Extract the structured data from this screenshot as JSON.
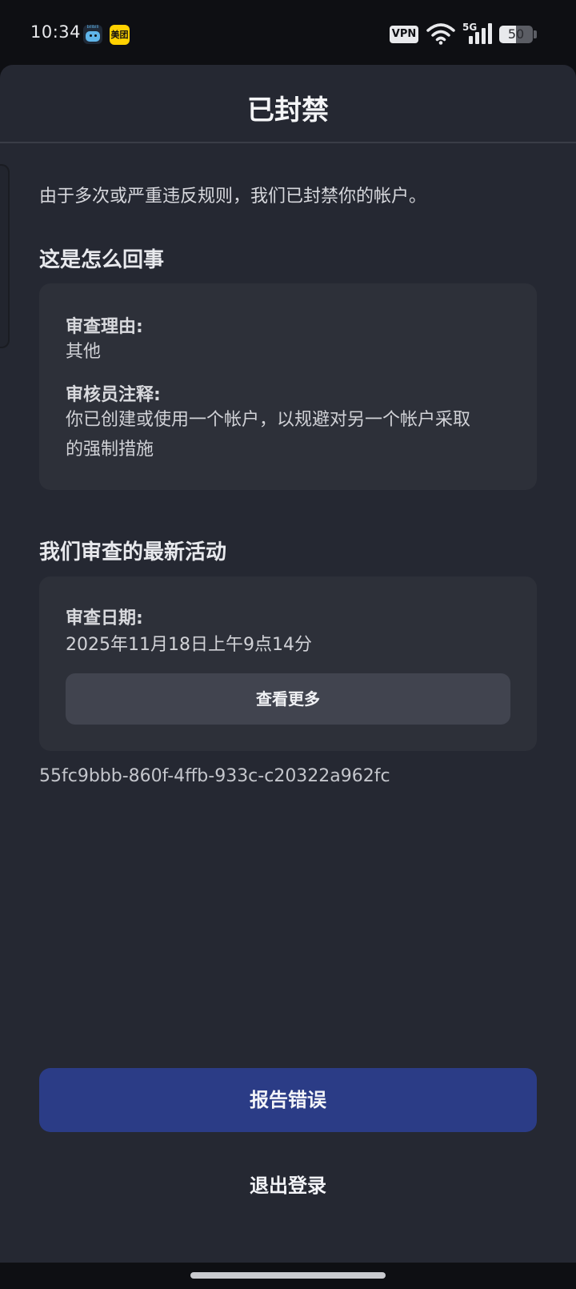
{
  "status_bar": {
    "time": "10:34",
    "app1_icon_text": "bilibili",
    "app2_icon_text": "美团",
    "vpn_label": "VPN",
    "network_label": "5G",
    "battery_level": "50",
    "battery_fraction": 0.5,
    "icons": [
      "bilibili-app-icon",
      "meituan-app-icon",
      "vpn-icon",
      "wifi-icon",
      "5g-signal-icon",
      "battery-icon"
    ]
  },
  "sheet": {
    "title": "已封禁",
    "intro": "由于多次或严重违反规则，我们已封禁你的帐户。"
  },
  "what_happened": {
    "heading": "这是怎么回事",
    "reason_label": "审查理由:",
    "reason_value": "其他",
    "note_label": "审核员注释:",
    "note_line1": "你已创建或使用一个帐户，以规避对另一个帐户采取",
    "note_line2": "的强制措施"
  },
  "latest_activity": {
    "heading": "我们审查的最新活动",
    "date_label": "审查日期:",
    "date_value": "2025年11月18日上午9点14分",
    "see_more_label": "查看更多"
  },
  "reference_id": "55fc9bbb-860f-4ffb-933c-c20322a962fc",
  "actions": {
    "report_error_label": "报告错误",
    "logout_label": "退出登录"
  },
  "colors": {
    "background": "#0e0f13",
    "sheet": "#252832",
    "card": "#2d3039",
    "see_more_button": "#41444f",
    "primary_button": "#2b3c86"
  }
}
